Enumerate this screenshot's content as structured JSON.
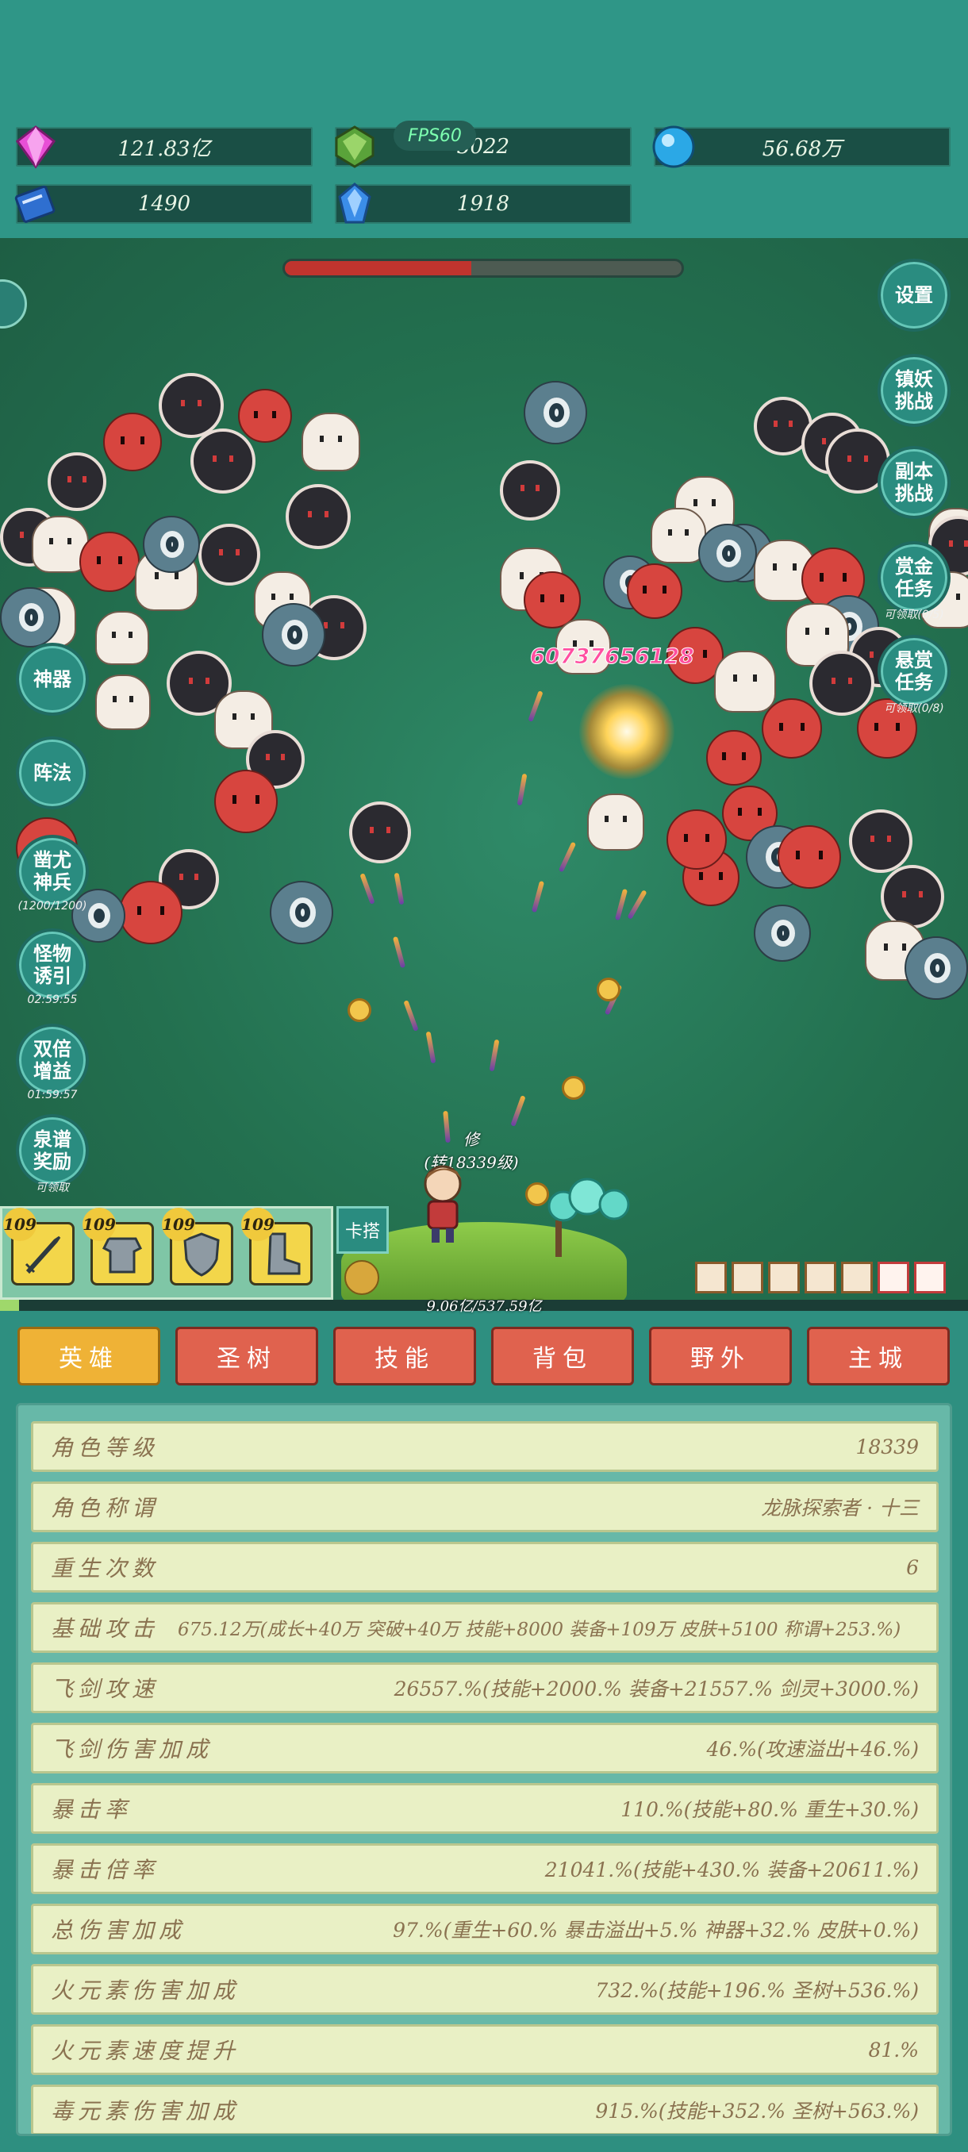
{
  "resources": [
    {
      "icon": "pink-diamond-icon",
      "value": "121.83亿"
    },
    {
      "icon": "green-gem-icon",
      "value": "3022"
    },
    {
      "icon": "blue-orb-icon",
      "value": "56.68万"
    },
    {
      "icon": "blue-book-icon",
      "value": "1490"
    },
    {
      "icon": "blue-crystal-icon",
      "value": "1918"
    }
  ],
  "fps": "FPS60",
  "boss_hp_fraction": 0.47,
  "left_buttons": [
    {
      "label": "神器",
      "sub": ""
    },
    {
      "label": "阵法",
      "sub": ""
    },
    {
      "label": "凿尤神兵",
      "sub": "(1200/1200)"
    },
    {
      "label": "怪物诱引",
      "sub": "02:59:55"
    },
    {
      "label": "双倍增益",
      "sub": "01:59:57"
    },
    {
      "label": "泉谱奖励",
      "sub": "可领取"
    }
  ],
  "right_buttons": [
    {
      "label": "设置",
      "sub": ""
    },
    {
      "label": "镇妖挑战",
      "sub": ""
    },
    {
      "label": "副本挑战",
      "sub": ""
    },
    {
      "label": "赏金任务",
      "sub": "可领取(0/5)"
    },
    {
      "label": "悬赏任务",
      "sub": "可领取(0/8)"
    }
  ],
  "damage_number": "60737656128",
  "hero": {
    "name": "修",
    "level_text": "(转18339级)"
  },
  "equipment": [
    {
      "name": "sword",
      "level": "109"
    },
    {
      "name": "armor",
      "level": "109"
    },
    {
      "name": "shield",
      "level": "109"
    },
    {
      "name": "boots",
      "level": "109"
    }
  ],
  "stuck_button": "卡搭",
  "exp": {
    "text": "9.06亿/537.59亿",
    "fraction": 0.02
  },
  "tabs": [
    "英雄",
    "圣树",
    "技能",
    "背包",
    "野外",
    "主城"
  ],
  "active_tab": "英雄",
  "stats": [
    {
      "label": "角色等级",
      "value": "18339"
    },
    {
      "label": "角色称谓",
      "value": "龙脉探索者 · 十三"
    },
    {
      "label": "重生次数",
      "value": "6"
    },
    {
      "label": "基础攻击",
      "value": "675.12万(成长+40万 突破+40万 技能+8000 装备+109万 皮肤+5100 称谓+253.%)"
    },
    {
      "label": "飞剑攻速",
      "value": "26557.%(技能+2000.% 装备+21557.% 剑灵+3000.%)"
    },
    {
      "label": "飞剑伤害加成",
      "value": "46.%(攻速溢出+46.%)"
    },
    {
      "label": "暴击率",
      "value": "110.%(技能+80.% 重生+30.%)"
    },
    {
      "label": "暴击倍率",
      "value": "21041.%(技能+430.% 装备+20611.%)"
    },
    {
      "label": "总伤害加成",
      "value": "97.%(重生+60.% 暴击溢出+5.% 神器+32.% 皮肤+0.%)"
    },
    {
      "label": "火元素伤害加成",
      "value": "732.%(技能+196.% 圣树+536.%)"
    },
    {
      "label": "火元素速度提升",
      "value": "81.%"
    },
    {
      "label": "毒元素伤害加成",
      "value": "915.%(技能+352.% 圣树+563.%)"
    }
  ]
}
